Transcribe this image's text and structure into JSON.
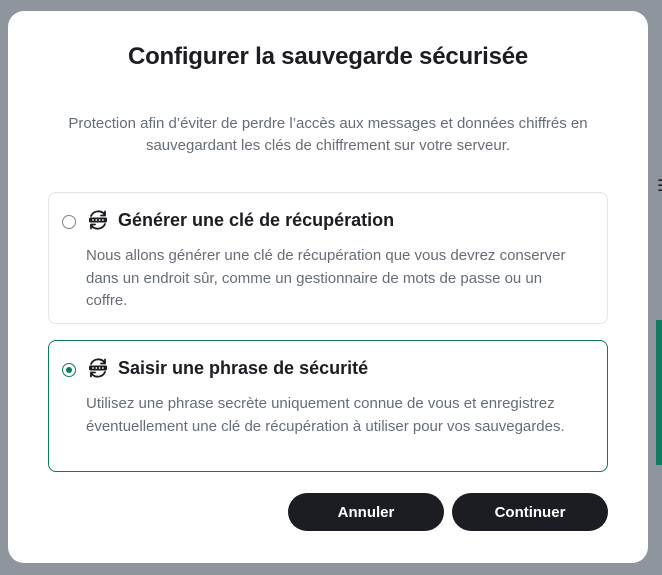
{
  "dialog": {
    "title": "Configurer la sauvegarde sécurisée",
    "description": "Protection afin d’éviter de perdre l’accès aux messages et données chiffrés en sauvegardant les clés de chiffrement sur votre serveur."
  },
  "options": [
    {
      "title": "Générer une clé de récupération",
      "description": "Nous allons générer une clé de récupération que vous devrez conserver dans un endroit sûr, comme un gestionnaire de mots de passe ou un coffre.",
      "selected": false,
      "icon": "key-sync-icon"
    },
    {
      "title": "Saisir une phrase de sécurité",
      "description": "Utilisez une phrase secrète uniquement connue de vous et enregistrez éventuellement une clé de récupération à utiliser pour vos sauvegardes.",
      "selected": true,
      "icon": "password-sync-icon"
    }
  ],
  "buttons": {
    "cancel": "Annuler",
    "continue": "Continuer"
  },
  "colors": {
    "accent": "#0d7a5e",
    "button_bg": "#1b1d22",
    "overlay": "#8f959c"
  }
}
